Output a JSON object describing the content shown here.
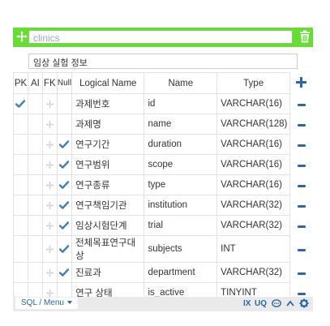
{
  "table": {
    "name": "clinics",
    "comment": "임상 실험 정보"
  },
  "headers": {
    "pk": "PK",
    "ai": "AI",
    "fk": "FK",
    "null": "Null",
    "logical": "Logical Name",
    "name": "Name",
    "type": "Type"
  },
  "rows": [
    {
      "pk": true,
      "null": false,
      "logical": "과제번호",
      "name": "id",
      "type": "VARCHAR(16)"
    },
    {
      "pk": false,
      "null": false,
      "logical": "과제명",
      "name": "name",
      "type": "VARCHAR(128)"
    },
    {
      "pk": false,
      "null": true,
      "logical": "연구기간",
      "name": "duration",
      "type": "VARCHAR(16)"
    },
    {
      "pk": false,
      "null": true,
      "logical": "연구범위",
      "name": "scope",
      "type": "VARCHAR(16)"
    },
    {
      "pk": false,
      "null": true,
      "logical": "연구종류",
      "name": "type",
      "type": "VARCHAR(16)"
    },
    {
      "pk": false,
      "null": true,
      "logical": "연구책임기관",
      "name": "institution",
      "type": "VARCHAR(32)"
    },
    {
      "pk": false,
      "null": true,
      "logical": "임상시험단계",
      "name": "trial",
      "type": "VARCHAR(32)"
    },
    {
      "pk": false,
      "null": true,
      "logical": "전체목표연구대상",
      "name": "subjects",
      "type": "INT"
    },
    {
      "pk": false,
      "null": true,
      "logical": "진료과",
      "name": "department",
      "type": "VARCHAR(32)"
    },
    {
      "pk": false,
      "null": false,
      "logical": "연구 상태",
      "name": "is_active",
      "type": "TINYINT"
    }
  ],
  "footer": {
    "sql_menu": "SQL / Menu",
    "ix": "IX",
    "uq": "UQ"
  },
  "colors": {
    "titlebar": "#66dd33",
    "accent": "#2a66a8",
    "check": "#3a7fb8"
  },
  "icons": [
    "move-icon",
    "trash-icon",
    "plus-icon",
    "minus-icon",
    "check-icon",
    "link-icon",
    "comment-icon",
    "collapse-icon",
    "gear-icon"
  ]
}
